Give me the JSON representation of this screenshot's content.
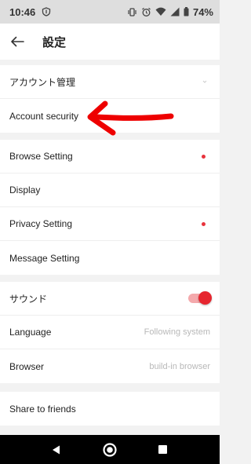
{
  "status_bar": {
    "time": "10:46",
    "battery": "74%"
  },
  "header": {
    "title": "設定"
  },
  "sections": [
    {
      "items": [
        {
          "label": "アカウント管理"
        },
        {
          "label": "Account security"
        }
      ]
    },
    {
      "items": [
        {
          "label": "Browse Setting",
          "has_red_dot": true
        },
        {
          "label": "Display"
        },
        {
          "label": "Privacy Setting",
          "has_red_dot": true
        },
        {
          "label": "Message Setting"
        }
      ]
    },
    {
      "items": [
        {
          "label": "サウンド",
          "toggle_on": true
        },
        {
          "label": "Language",
          "value": "Following system"
        },
        {
          "label": "Browser",
          "value": "build-in browser"
        }
      ]
    },
    {
      "items": [
        {
          "label": "Share to friends"
        }
      ]
    }
  ],
  "colors": {
    "accent": "#e6262f",
    "status_bar_bg": "#dedede",
    "page_bg": "#f2f2f2",
    "annotation_arrow": "#ee0000"
  },
  "icons": {
    "status": [
      "shield-icon",
      "vibrate-icon",
      "alarm-icon",
      "wifi-icon",
      "signal-icon",
      "battery-icon"
    ],
    "header": "back-arrow-icon",
    "nav": [
      "back-triangle-icon",
      "home-circle-icon",
      "recents-square-icon"
    ]
  }
}
